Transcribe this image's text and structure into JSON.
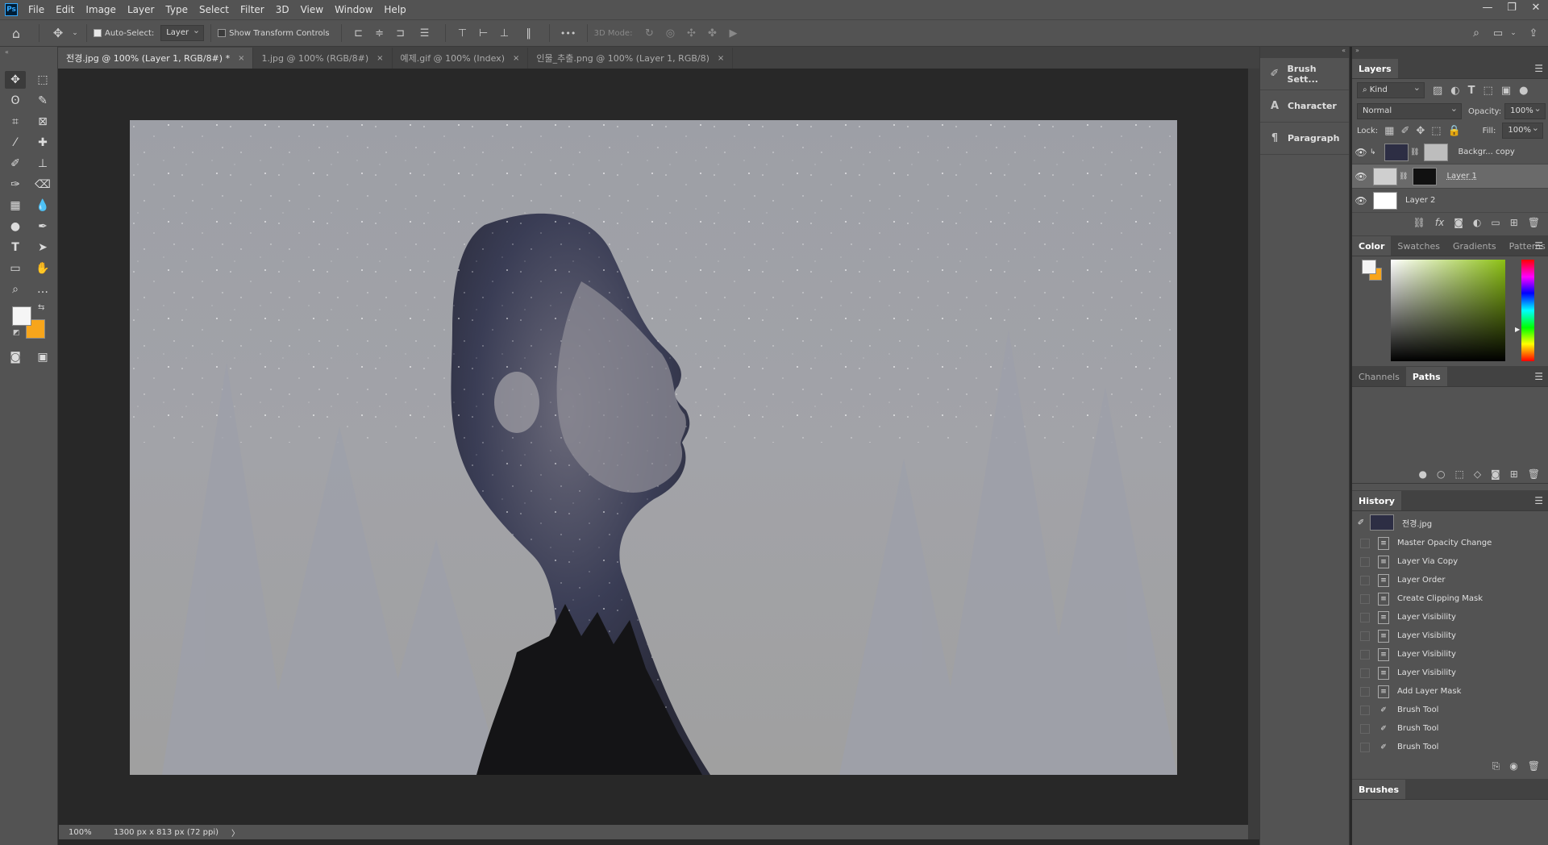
{
  "menubar": {
    "logo": "Ps",
    "items": [
      "File",
      "Edit",
      "Image",
      "Layer",
      "Type",
      "Select",
      "Filter",
      "3D",
      "View",
      "Window",
      "Help"
    ],
    "window_controls": [
      "—",
      "❐",
      "✕"
    ]
  },
  "options": {
    "auto_select_label": "Auto-Select:",
    "auto_select_value": "Layer",
    "show_transform_label": "Show Transform Controls",
    "mode_3d_label": "3D Mode:",
    "more_label": "•••"
  },
  "tabs": [
    {
      "label": "전경.jpg @ 100% (Layer 1, RGB/8#) *",
      "close": "×"
    },
    {
      "label": "1.jpg @ 100% (RGB/8#)",
      "close": "×"
    },
    {
      "label": "예제.gif @ 100% (Index)",
      "close": "×"
    },
    {
      "label": "인물_추출.png @ 100% (Layer 1, RGB/8)",
      "close": "×"
    }
  ],
  "status": {
    "zoom": "100%",
    "doc_info": "1300 px x 813 px (72 ppi)",
    "arrow": "〉"
  },
  "mini_panels": [
    {
      "label": "Brush Sett...",
      "icon": "brush-settings-icon"
    },
    {
      "label": "Character",
      "icon": "character-icon"
    },
    {
      "label": "Paragraph",
      "icon": "paragraph-icon"
    }
  ],
  "layers_panel": {
    "title": "Layers",
    "kind_label": "Kind",
    "blend_mode": "Normal",
    "opacity_label": "Opacity:",
    "opacity_value": "100%",
    "lock_label": "Lock:",
    "fill_label": "Fill:",
    "fill_value": "100%",
    "layers": [
      {
        "name": "Backgr... copy",
        "selected": false
      },
      {
        "name": "Layer 1",
        "selected": true
      },
      {
        "name": "Layer 2",
        "selected": false
      }
    ]
  },
  "color_panel": {
    "tabs": [
      "Color",
      "Swatches",
      "Gradients",
      "Patterns"
    ],
    "foreground": "#f5f5f5",
    "background": "#f7a51b",
    "hue_color": "#8cc014"
  },
  "paths_panel": {
    "tabs": [
      "Channels",
      "Paths"
    ]
  },
  "history_panel": {
    "title": "History",
    "snapshot": "전경.jpg",
    "items": [
      "Master Opacity Change",
      "Layer Via Copy",
      "Layer Order",
      "Create Clipping Mask",
      "Layer Visibility",
      "Layer Visibility",
      "Layer Visibility",
      "Layer Visibility",
      "Add Layer Mask",
      "Brush Tool",
      "Brush Tool",
      "Brush Tool"
    ]
  },
  "brushes_panel": {
    "title": "Brushes"
  },
  "colors": {
    "ui_bg": "#535353",
    "dark_bg": "#282828",
    "accent": "#31a8ff"
  }
}
